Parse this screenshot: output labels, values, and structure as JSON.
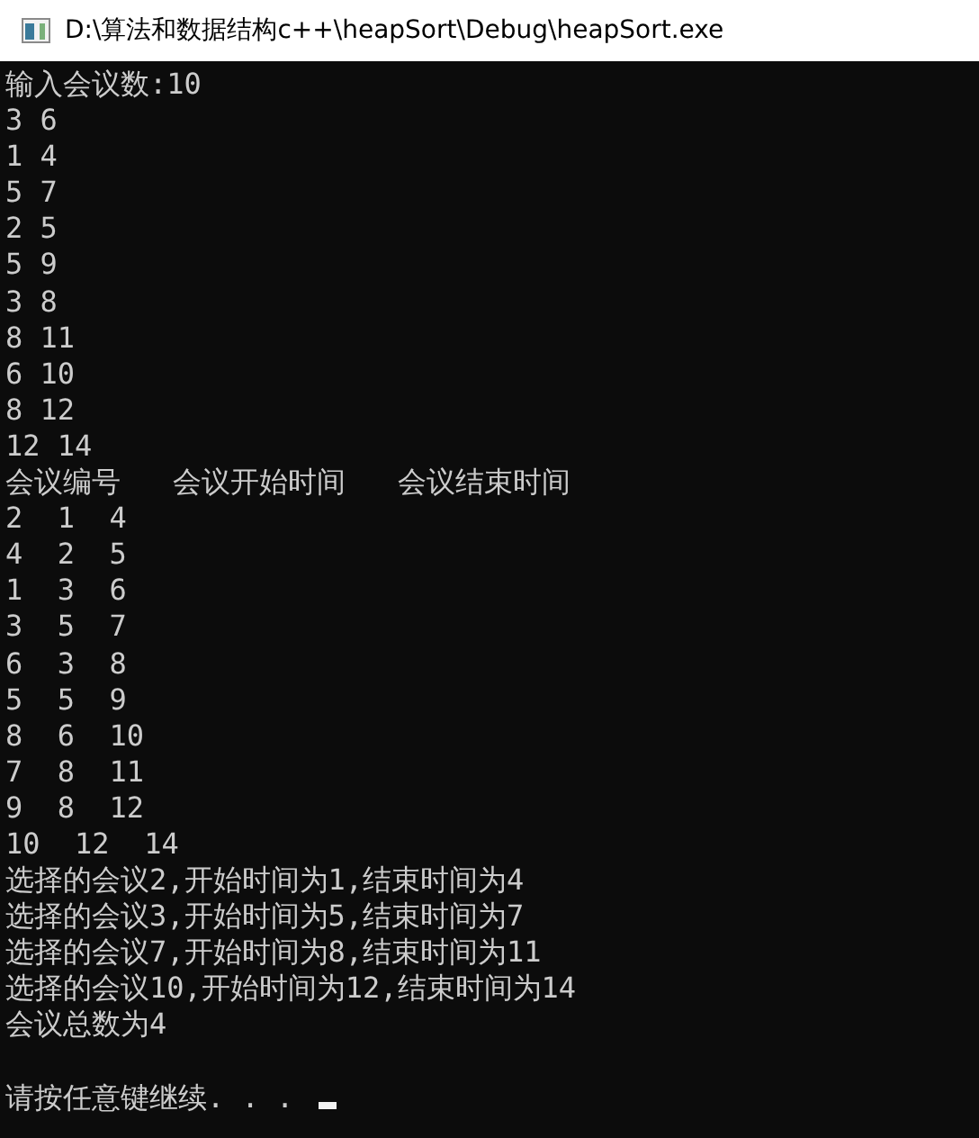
{
  "window": {
    "title": "D:\\算法和数据结构c++\\heapSort\\Debug\\heapSort.exe"
  },
  "console": {
    "lines": [
      "输入会议数:10",
      "3 6",
      "1 4",
      "5 7",
      "2 5",
      "5 9",
      "3 8",
      "8 11",
      "6 10",
      "8 12",
      "12 14",
      "会议编号   会议开始时间   会议结束时间",
      "2  1  4",
      "4  2  5",
      "1  3  6",
      "3  5  7",
      "6  3  8",
      "5  5  9",
      "8  6  10",
      "7  8  11",
      "9  8  12",
      "10  12  14",
      "选择的会议2,开始时间为1,结束时间为4",
      "选择的会议3,开始时间为5,结束时间为7",
      "选择的会议7,开始时间为8,结束时间为11",
      "选择的会议10,开始时间为12,结束时间为14",
      "会议总数为4"
    ],
    "prompt": "请按任意键继续. . . "
  }
}
